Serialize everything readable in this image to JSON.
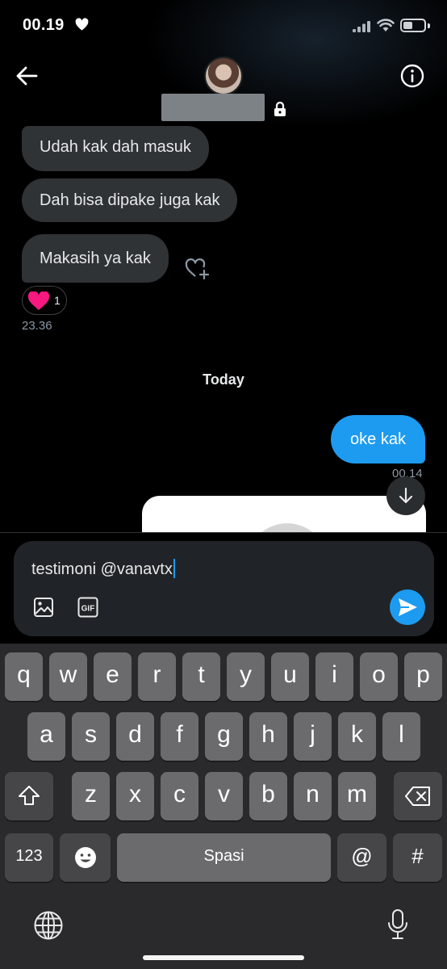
{
  "status_bar": {
    "time": "00.19"
  },
  "conversation": {
    "messages_in": [
      {
        "text": "Udah kak dah masuk"
      },
      {
        "text": "Dah bisa dipake juga kak"
      },
      {
        "text": "Makasih ya kak"
      }
    ],
    "reaction": {
      "emoji": "heart",
      "count": "1"
    },
    "time_in": "23.36",
    "day_divider": "Today",
    "message_out": {
      "text": "oke kak",
      "time": "00.14"
    }
  },
  "composer": {
    "value": "testimoni @vanavtx",
    "gif_label": "GIF"
  },
  "keyboard": {
    "row1": [
      "q",
      "w",
      "e",
      "r",
      "t",
      "y",
      "u",
      "i",
      "o",
      "p"
    ],
    "row2": [
      "a",
      "s",
      "d",
      "f",
      "g",
      "h",
      "j",
      "k",
      "l"
    ],
    "row3": [
      "z",
      "x",
      "c",
      "v",
      "b",
      "n",
      "m"
    ],
    "numbers_label": "123",
    "space_label": "Spasi",
    "at_label": "@",
    "hash_label": "#"
  },
  "colors": {
    "accent": "#1d9bf0",
    "bubble_in": "#2f3336",
    "reaction_heart": "#f91880"
  }
}
